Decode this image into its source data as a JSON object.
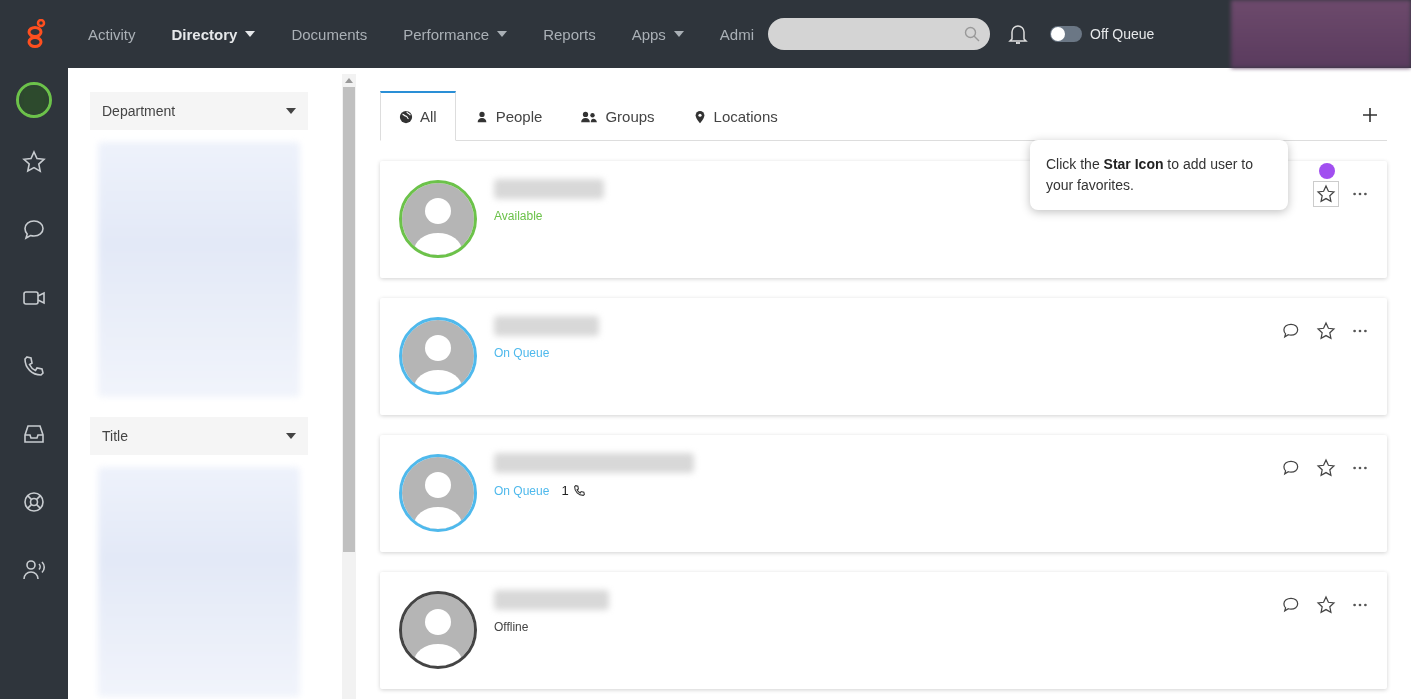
{
  "topbar": {
    "nav": [
      {
        "label": "Activity",
        "selected": false,
        "dropdown": false
      },
      {
        "label": "Directory",
        "selected": true,
        "dropdown": true
      },
      {
        "label": "Documents",
        "selected": false,
        "dropdown": false
      },
      {
        "label": "Performance",
        "selected": false,
        "dropdown": true
      },
      {
        "label": "Reports",
        "selected": false,
        "dropdown": false
      },
      {
        "label": "Apps",
        "selected": false,
        "dropdown": true
      },
      {
        "label": "Admi",
        "selected": false,
        "dropdown": false
      }
    ],
    "queue_toggle": {
      "label": "Off Queue",
      "on": false
    }
  },
  "rail": [
    {
      "kind": "star"
    },
    {
      "kind": "chat"
    },
    {
      "kind": "video"
    },
    {
      "kind": "phone"
    },
    {
      "kind": "inbox"
    },
    {
      "kind": "help"
    },
    {
      "kind": "speaker"
    }
  ],
  "filters": [
    {
      "label": "Department"
    },
    {
      "label": "Title"
    }
  ],
  "tabs": [
    {
      "label": "All",
      "kind": "globe",
      "selected": true
    },
    {
      "label": "People",
      "kind": "person",
      "selected": false
    },
    {
      "label": "Groups",
      "kind": "group",
      "selected": false
    },
    {
      "label": "Locations",
      "kind": "pin",
      "selected": false
    }
  ],
  "people": [
    {
      "status": "Available",
      "color": "#6cc24a",
      "chat_button": false,
      "star_highlighted": true
    },
    {
      "status": "On Queue",
      "color": "#4fb9ec",
      "chat_button": true,
      "star_highlighted": false
    },
    {
      "status": "On Queue",
      "color": "#4fb9ec",
      "chat_button": true,
      "star_highlighted": false,
      "calls": "1"
    },
    {
      "status": "Offline",
      "color": "#444444",
      "chat_button": true,
      "star_highlighted": false
    }
  ],
  "tooltip": {
    "text": "Click the **Star Icon** to add user to your favorites."
  }
}
